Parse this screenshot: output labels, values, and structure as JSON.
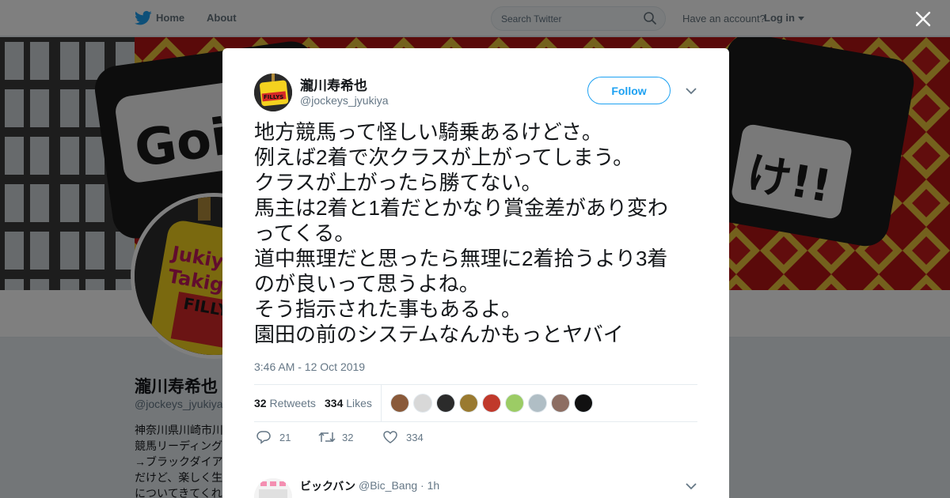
{
  "nav": {
    "home": "Home",
    "about": "About",
    "search_placeholder": "Search Twitter",
    "have_account": "Have an account?",
    "login": "Log in"
  },
  "profile_bg": {
    "name": "瀧川寿希也",
    "handle": "@jockeys_jyukiya",
    "bio_lines": [
      "神奈川県川崎市川",
      "競馬リーディング",
      "→ブラックダイア",
      "だけど、楽しく生",
      "についてきてくれ"
    ],
    "banner_text": "Goin",
    "banner_text_right": "け!!",
    "avatar_text_1": "Jukiya",
    "avatar_text_2": "Takig",
    "avatar_text_3": "FILLY"
  },
  "tweet": {
    "author_name": "瀧川寿希也",
    "author_handle": "@jockeys_jyukiya",
    "avatar_badge_text": "FILLYS",
    "follow_label": "Follow",
    "lines": [
      "地方競馬って怪しい騎乗あるけどさ。",
      "例えば2着で次クラスが上がってしまう。",
      "クラスが上がったら勝てない。",
      "馬主は2着と1着だとかなり賞金差があり変わ",
      "ってくる。",
      "道中無理だと思ったら無理に2着拾うより3着",
      "のが良いって思うよね。",
      "そう指示された事もあるよ。",
      "園田の前のシステムなんかもっとヤバイ"
    ],
    "timestamp": "3:46 AM - 12 Oct 2019",
    "retweets_count": "32",
    "retweets_label": "Retweets",
    "likes_count": "334",
    "likes_label": "Likes",
    "liker_colors": [
      "#8a5a3a",
      "#d8d8d8",
      "#2b2b2b",
      "#9a7a30",
      "#c0392b",
      "#9ccc65",
      "#b0bec5",
      "#8d6e63",
      "#111111"
    ],
    "actions": {
      "reply_count": "21",
      "retweet_count": "32",
      "like_count": "334"
    }
  },
  "reply": {
    "name": "ビックバン",
    "handle": "@Bic_Bang",
    "time": "· 1h"
  },
  "colors": {
    "brand": "#1da1f2",
    "text": "#14171a",
    "muted": "#657786"
  }
}
